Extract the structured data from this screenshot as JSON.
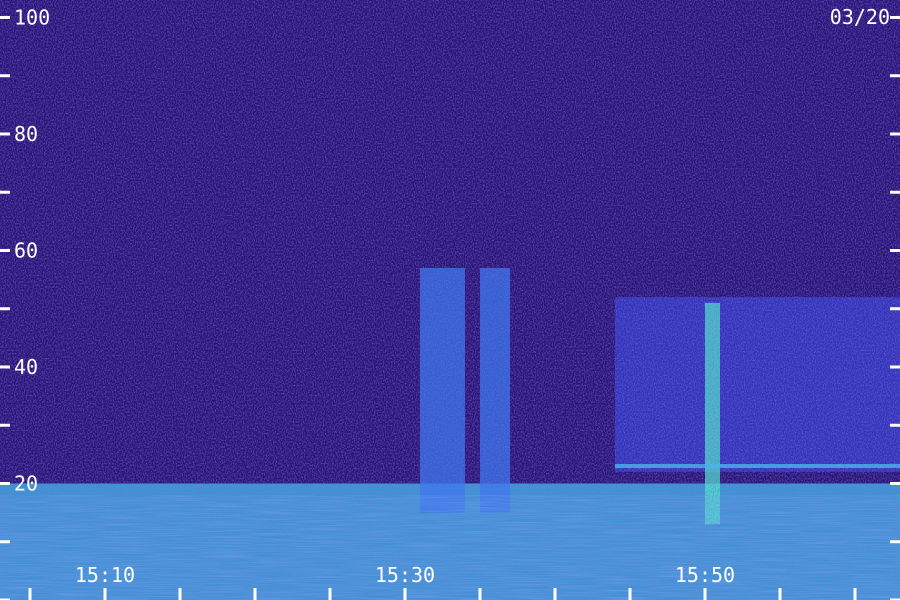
{
  "chart_data": {
    "type": "heatmap",
    "title": "",
    "xlabel": "",
    "ylabel": "",
    "date_label": "03/20",
    "x_ticks": [
      "15:10",
      "15:30",
      "15:50"
    ],
    "y_ticks": [
      20,
      40,
      60,
      80,
      100
    ],
    "ylim": [
      0,
      103
    ],
    "xlim": [
      "15:03",
      "15:63"
    ],
    "colormap": [
      "#1d0e4a",
      "#2a1a8c",
      "#3040d0",
      "#2f7cf0",
      "#3cc8f0",
      "#4af0c8"
    ],
    "features": [
      {
        "kind": "noise-floor",
        "freq_range": [
          0,
          103
        ],
        "intensity": 0.18
      },
      {
        "kind": "low-frequency-band",
        "freq_range": [
          0,
          20
        ],
        "intensity": 0.75
      },
      {
        "kind": "band",
        "time_range": [
          "15:31",
          "15:34"
        ],
        "freq_range": [
          15,
          57
        ],
        "intensity": 0.55
      },
      {
        "kind": "band",
        "time_range": [
          "15:35",
          "15:37"
        ],
        "freq_range": [
          15,
          57
        ],
        "intensity": 0.55
      },
      {
        "kind": "block",
        "time_range": [
          "15:44",
          "15:63"
        ],
        "freq_range": [
          22,
          52
        ],
        "intensity": 0.45
      },
      {
        "kind": "spike",
        "time_range": [
          "15:50",
          "15:51"
        ],
        "freq_range": [
          13,
          51
        ],
        "intensity": 0.9
      },
      {
        "kind": "horizontal-line",
        "time_range": [
          "15:44",
          "15:63"
        ],
        "freq": 23,
        "intensity": 0.7
      }
    ]
  }
}
